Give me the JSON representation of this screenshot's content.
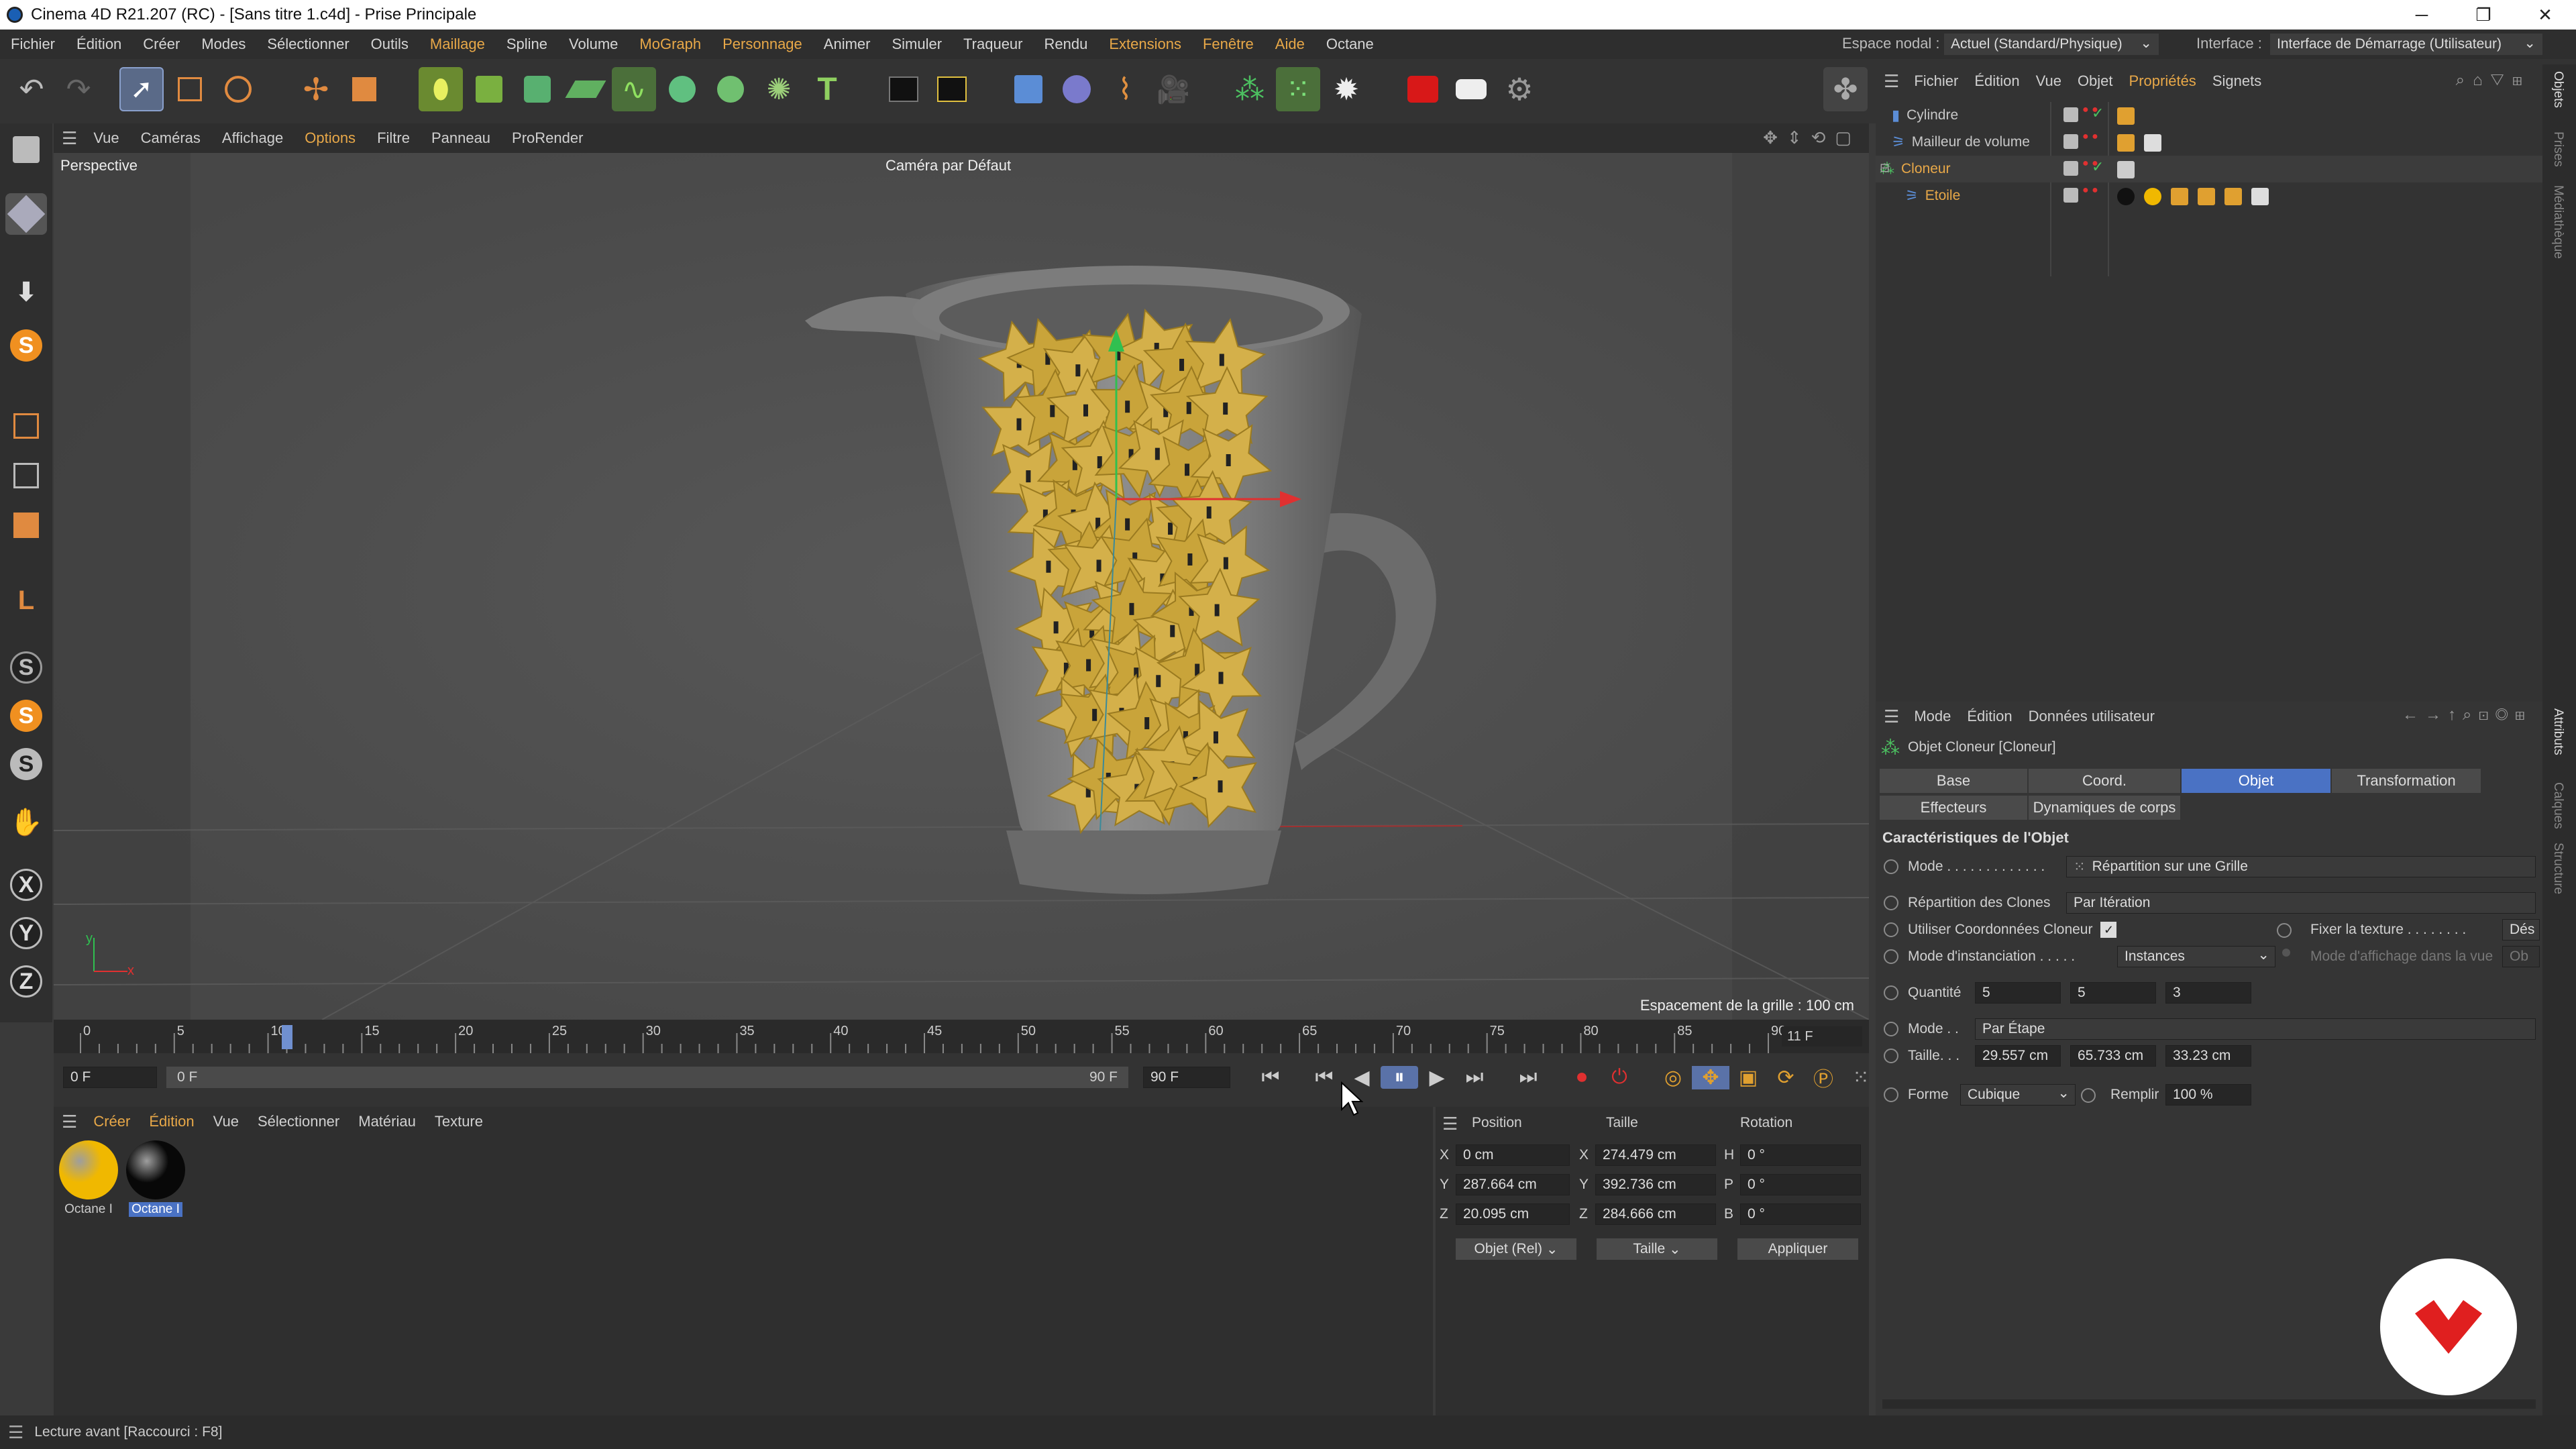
{
  "window": {
    "title": "Cinema 4D R21.207 (RC) - [Sans titre 1.c4d] - Prise Principale",
    "minimize": "─",
    "restore": "❐",
    "close": "✕"
  },
  "menubar": {
    "items": [
      "Fichier",
      "Édition",
      "Créer",
      "Modes",
      "Sélectionner",
      "Outils",
      "Maillage",
      "Spline",
      "Volume",
      "MoGraph",
      "Personnage",
      "Animer",
      "Simuler",
      "Traqueur",
      "Rendu",
      "Extensions",
      "Fenêtre",
      "Aide",
      "Octane"
    ],
    "nodal_label": "Espace nodal :",
    "nodal_value": "Actuel (Standard/Physique)",
    "interface_label": "Interface :",
    "interface_value": "Interface de Démarrage (Utilisateur)"
  },
  "viewport": {
    "menu": [
      "Vue",
      "Caméras",
      "Affichage",
      "Options",
      "Filtre",
      "Panneau",
      "ProRender"
    ],
    "label": "Perspective",
    "camera": "Caméra par Défaut",
    "grid_spacing": "Espacement de la grille : 100 cm",
    "axis_y": "y",
    "axis_x": "x"
  },
  "timeline": {
    "ticks": [
      "0",
      "5",
      "10",
      "15",
      "20",
      "25",
      "30",
      "35",
      "40",
      "45",
      "50",
      "55",
      "60",
      "65",
      "70",
      "75",
      "80",
      "85",
      "90"
    ],
    "current_frame_display": "11 F",
    "start_field": "0 F",
    "range_start": "0 F",
    "range_end": "90 F",
    "end_field": "90 F",
    "playhead_frame": 11
  },
  "materials": {
    "menu": [
      "Créer",
      "Édition",
      "Vue",
      "Sélectionner",
      "Matériau",
      "Texture"
    ],
    "items": [
      {
        "label": "Octane I",
        "color": "#f0b800"
      },
      {
        "label": "Octane I",
        "color": "#080808"
      }
    ]
  },
  "coords": {
    "headers": [
      "Position",
      "Taille",
      "Rotation"
    ],
    "rows": [
      {
        "axis": "X",
        "pos": "0 cm",
        "saxis": "X",
        "size": "274.479 cm",
        "raxis": "H",
        "rot": "0 °"
      },
      {
        "axis": "Y",
        "pos": "287.664 cm",
        "saxis": "Y",
        "size": "392.736 cm",
        "raxis": "P",
        "rot": "0 °"
      },
      {
        "axis": "Z",
        "pos": "20.095 cm",
        "saxis": "Z",
        "size": "284.666 cm",
        "raxis": "B",
        "rot": "0 °"
      }
    ],
    "mode1": "Objet (Rel)",
    "mode2": "Taille",
    "apply": "Appliquer"
  },
  "objects": {
    "menu": [
      "Fichier",
      "Édition",
      "Vue",
      "Objet",
      "Propriétés",
      "Signets"
    ],
    "items": [
      {
        "name": "Cylindre",
        "color": "#c8c8c8"
      },
      {
        "name": "Mailleur de volume",
        "color": "#c8c8c8"
      },
      {
        "name": "Cloneur",
        "color": "#e8a848"
      },
      {
        "name": "Etoile",
        "color": "#e8a848"
      }
    ]
  },
  "attributes": {
    "menu": [
      "Mode",
      "Édition",
      "Données utilisateur"
    ],
    "object_title": "Objet Cloneur [Cloneur]",
    "tabs": [
      "Base",
      "Coord.",
      "Objet",
      "Transformation",
      "Effecteurs",
      "Dynamiques de corps"
    ],
    "active_tab": "Objet",
    "section": "Caractéristiques de l'Objet",
    "mode_label": "Mode . . . . . . . . . . . . .",
    "mode_value": "Répartition sur une Grille",
    "repartition_label": "Répartition des Clones",
    "repartition_value": "Par Itération",
    "coords_label": "Utiliser Coordonnées Cloneur",
    "fix_texture_label": "Fixer la texture . . . . . . . .",
    "fix_texture_value": "Dés",
    "instanciation_label": "Mode d'instanciation . . . . .",
    "instanciation_value": "Instances",
    "display_mode_label": "Mode d'affichage dans la vue",
    "display_mode_value": "Ob",
    "quantite_label": "Quantité",
    "quantite": [
      "5",
      "5",
      "3"
    ],
    "mode2_label": "Mode . .",
    "mode2_value": "Par Étape",
    "taille_label": "Taille. . .",
    "taille": [
      "29.557 cm",
      "65.733 cm",
      "33.23 cm"
    ],
    "forme_label": "Forme",
    "forme_value": "Cubique",
    "remplir_label": "Remplir",
    "remplir_value": "100 %"
  },
  "rightstrip": [
    "Objets",
    "Prises",
    "Médiathèque",
    "Attributs",
    "Calques",
    "Structure"
  ],
  "status": {
    "text": "Lecture avant [Raccourci : F8]"
  }
}
